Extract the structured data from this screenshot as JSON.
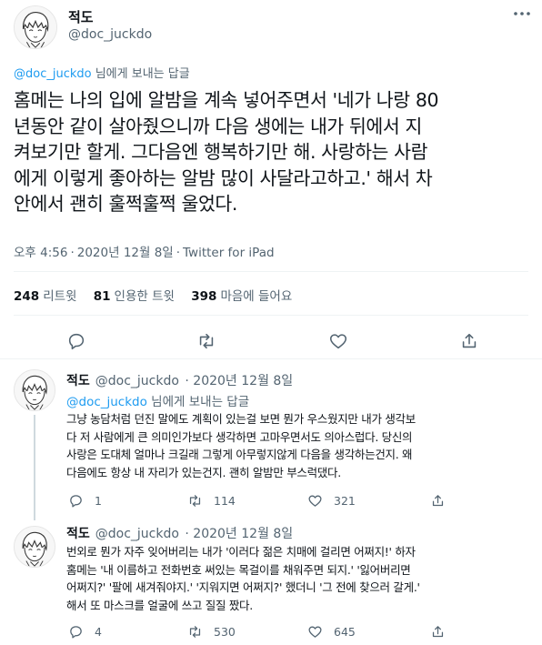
{
  "main_tweet": {
    "author_name": "적도",
    "author_handle": "@doc_juckdo",
    "reply_to_handle": "@doc_juckdo",
    "reply_to_suffix": " 님에게 보내는 답글",
    "text": "홈메는 나의 입에 알밤을 계속 넣어주면서 '네가 나랑 80\n년동안 같이 살아줬으니까 다음 생에는 내가 뒤에서 지\n켜보기만 할게. 그다음엔 행복하기만 해. 사랑하는 사람\n에게 이렇게 좋아하는 알밤 많이 사달라고하고.' 해서 차\n안에서 괜히 훌쩍훌쩍 울었다.",
    "time": "오후 4:56",
    "date": "2020년 12월 8일",
    "source": "Twitter for iPad",
    "stats": {
      "retweets_count": "248",
      "retweets_label": "리트윗",
      "quotes_count": "81",
      "quotes_label": "인용한 트윗",
      "likes_count": "398",
      "likes_label": "마음에 들어요"
    }
  },
  "replies": [
    {
      "author_name": "적도",
      "author_handle": "@doc_juckdo",
      "date": "2020년 12월 8일",
      "reply_to_handle": "@doc_juckdo",
      "reply_to_suffix": " 님에게 보내는 답글",
      "text": "그냥 농담처럼 던진 말에도 계획이 있는걸 보면 뭔가 우스웠지만 내가 생각보\n다 저 사람에게 큰 의미인가보다 생각하면 고마우면서도 의아스럽다. 당신의\n사랑은 도대체 얼마나 크길래 그렇게 아무렇지않게 다음을 생각하는건지. 왜\n다음에도 항상 내 자리가 있는건지. 괜히 알밤만 부스럭댔다.",
      "reply_count": "1",
      "retweet_count": "114",
      "like_count": "321"
    },
    {
      "author_name": "적도",
      "author_handle": "@doc_juckdo",
      "date": "2020년 12월 8일",
      "text": "번외로 뭔가 자주 잊어버리는 내가 '이러다 젊은 치매에 걸리면 어쩌지!' 하자\n홈메는 '내 이름하고 전화번호 써있는 목걸이를 채워주면 되지.' '잃어버리면\n어쩌지?' '팔에 새겨줘야지.' '지워지면 어쩌지?' 했더니 '그 전에 찾으러 갈게.'\n해서 또 마스크를 얼굴에 쓰고 질질 짰다.",
      "reply_count": "4",
      "retweet_count": "530",
      "like_count": "645"
    }
  ],
  "colors": {
    "accent": "#1d9bf0",
    "text": "#0f1419",
    "secondary": "#536471",
    "border": "#eff3f4"
  },
  "icons": [
    "more-icon",
    "reply-icon",
    "retweet-icon",
    "like-icon",
    "share-icon",
    "avatar-illustration"
  ]
}
